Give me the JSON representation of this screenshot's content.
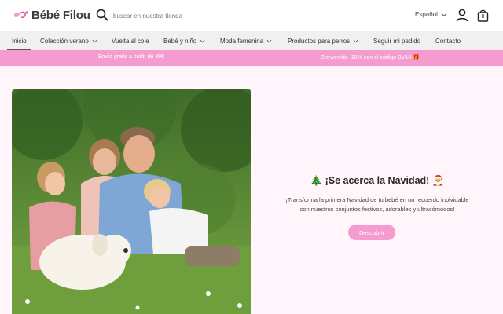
{
  "header": {
    "logo_text": "Bébé Filou",
    "search_placeholder": "buscar en nuestra tienda",
    "language": "Español",
    "cart_count": "0"
  },
  "nav": {
    "items": [
      {
        "label": "Inicio",
        "active": true
      },
      {
        "label": "Colección verano",
        "dropdown": true
      },
      {
        "label": "Vuelta al cole"
      },
      {
        "label": "Bebé y niño",
        "dropdown": true
      },
      {
        "label": "Moda femenina",
        "dropdown": true
      },
      {
        "label": "Productos para perros",
        "dropdown": true
      },
      {
        "label": "Seguir mi pedido"
      },
      {
        "label": "Contacto"
      }
    ]
  },
  "promo": {
    "left": "Envío gratis a partir de 39€",
    "right": "Bienvenido -10% con el código BV10 🎁"
  },
  "hero": {
    "title": "🎄 ¡Se acerca la Navidad! 🎅",
    "description_line1": "¡Transforma la primera Navidad de tu bebé en un recuerdo inolvidable",
    "description_line2": "con nuestros conjuntos festivos, adorables y ultracómodos!",
    "button": "Descubrir",
    "image_icon": "family-photo"
  },
  "colors": {
    "accent_pink": "#f49bcf",
    "hero_bg": "#fff5fa",
    "nav_bg": "#f0f0f0"
  }
}
